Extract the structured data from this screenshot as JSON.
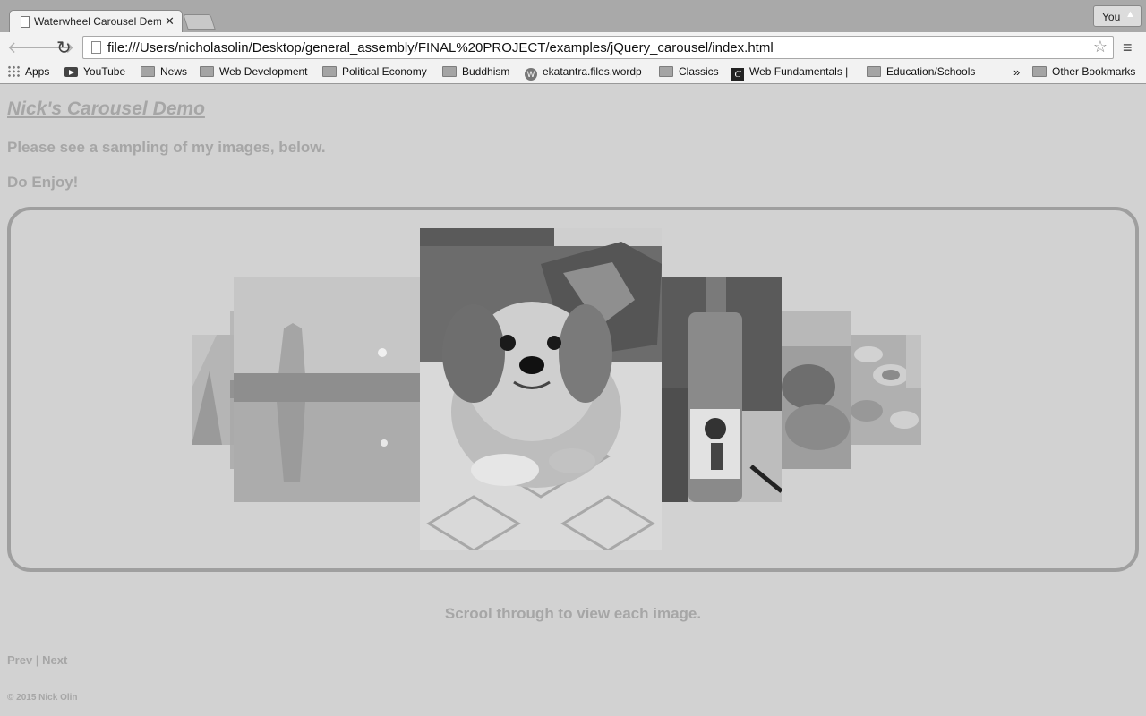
{
  "browser": {
    "tab_title": "Waterwheel Carousel Demo",
    "tab_close": "✕",
    "profile_label": "You",
    "url": "file:///Users/nicholasolin/Desktop/general_assembly/FINAL%20PROJECT/examples/jQuery_carousel/index.html",
    "back_icon": "🡐",
    "forward_icon": "🡒",
    "reload_icon": "↻",
    "star_icon": "☆",
    "menu_icon": "≡",
    "bookmarks": [
      {
        "label": "Apps",
        "icon": "apps-grid-icon"
      },
      {
        "label": "YouTube",
        "icon": "youtube-icon"
      },
      {
        "label": "News",
        "icon": "folder-icon"
      },
      {
        "label": "Web Development",
        "icon": "folder-icon"
      },
      {
        "label": "Political Economy",
        "icon": "folder-icon"
      },
      {
        "label": "Buddhism",
        "icon": "folder-icon"
      },
      {
        "label": "ekatantra.files.wordp",
        "icon": "wordpress-icon"
      },
      {
        "label": "Classics",
        "icon": "folder-icon"
      },
      {
        "label": "Web Fundamentals |",
        "icon": "codecademy-icon"
      },
      {
        "label": "Education/Schools",
        "icon": "folder-icon"
      }
    ],
    "bookmarks_overflow": "»",
    "other_bookmarks": "Other Bookmarks"
  },
  "page": {
    "title": "Nick's Carousel Demo",
    "intro": "Please see a sampling of my images, below.",
    "enjoy": "Do Enjoy!",
    "caption": "Scrool through to view each image.",
    "prev": "Prev",
    "separator": "|",
    "next": "Next",
    "footer": "© 2015 Nick Olin"
  },
  "carousel": {
    "slides": [
      {
        "name": "slide-monument-far"
      },
      {
        "name": "slide-monument-reflection"
      },
      {
        "name": "slide-lake-moon"
      },
      {
        "name": "slide-dog-center"
      },
      {
        "name": "slide-sake-bottle"
      },
      {
        "name": "slide-food-plate"
      },
      {
        "name": "slide-dinner-table-far"
      }
    ]
  }
}
